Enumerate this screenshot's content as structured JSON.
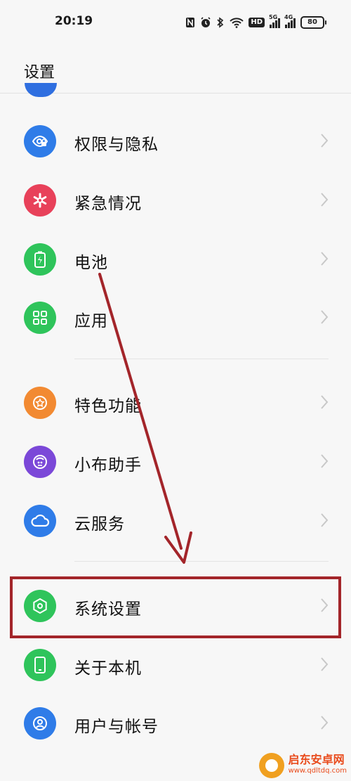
{
  "status_bar": {
    "time": "20:19",
    "icons": [
      "nfc-icon",
      "alarm-icon",
      "bluetooth-icon",
      "wifi-icon",
      "hd-icon",
      "signal-5g-icon",
      "signal-4g-icon",
      "battery-icon"
    ],
    "hd_label": "HD",
    "sig1_label": "5G",
    "sig2_label": "4G",
    "battery_level": "80"
  },
  "header": {
    "title": "设置"
  },
  "settings": {
    "items": [
      {
        "label": "权限与隐私",
        "icon": "eye-lock-icon",
        "color": "#2f7ce8"
      },
      {
        "label": "紧急情况",
        "icon": "asterisk-icon",
        "color": "#e8415a"
      },
      {
        "label": "电池",
        "icon": "battery-charge-icon",
        "color": "#2fc45b"
      },
      {
        "label": "应用",
        "icon": "apps-grid-icon",
        "color": "#2fc45b"
      },
      {
        "label": "特色功能",
        "icon": "star-badge-icon",
        "color": "#f28a32"
      },
      {
        "label": "小布助手",
        "icon": "assistant-icon",
        "color": "#7b48d8"
      },
      {
        "label": "云服务",
        "icon": "cloud-icon",
        "color": "#2f7ce8"
      },
      {
        "label": "系统设置",
        "icon": "hexagon-settings-icon",
        "color": "#2fc45b"
      },
      {
        "label": "关于本机",
        "icon": "phone-icon",
        "color": "#2fc45b"
      },
      {
        "label": "用户与帐号",
        "icon": "user-icon",
        "color": "#2f7ce8"
      }
    ]
  },
  "annotation": {
    "highlight_color": "#a3252a",
    "arrow_color": "#a3252a"
  },
  "watermark": {
    "name": "启东安卓网",
    "url": "www.qdltdq.com",
    "color": "#e94b1c"
  }
}
